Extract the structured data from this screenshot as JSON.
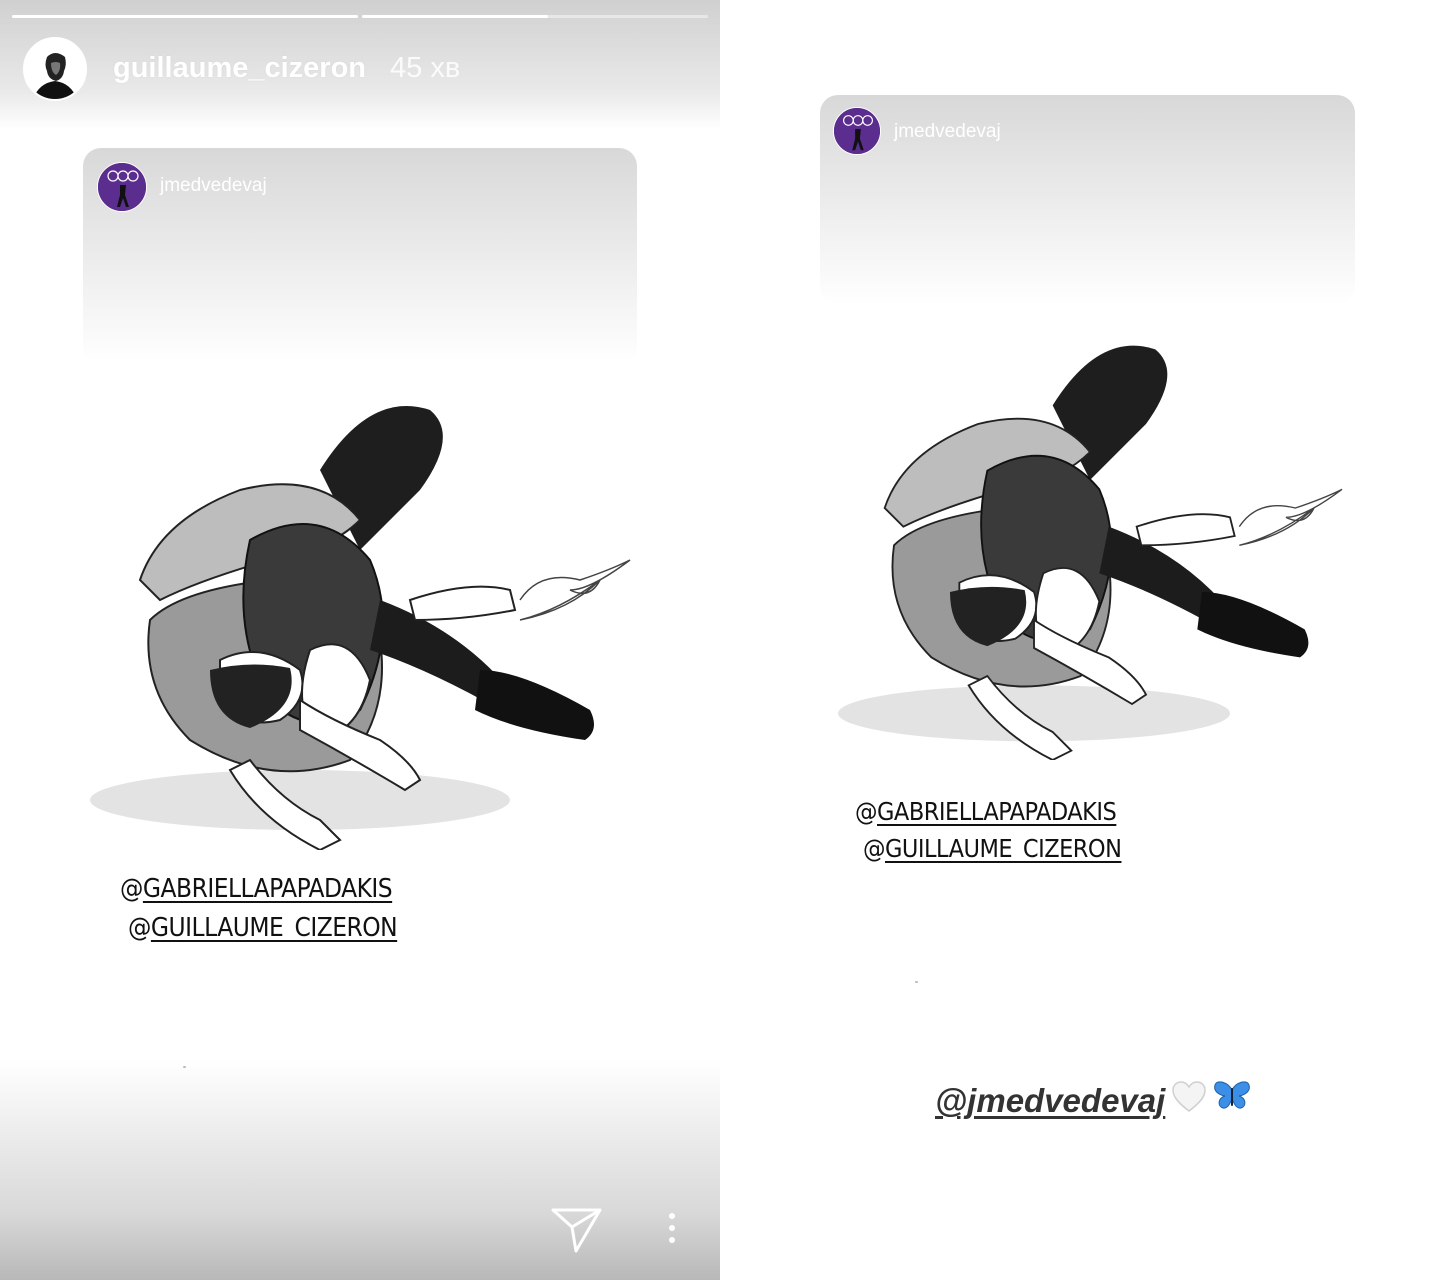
{
  "story": {
    "username": "guillaume_cizeron",
    "time": "45 хв",
    "progress_bars": [
      1.0,
      0.54
    ]
  },
  "repost": {
    "username": "jmedvedevaj"
  },
  "mentions": {
    "line1_at": "@",
    "line1_name": "GABRIELLAPAPADAKIS",
    "line2_at": "@",
    "line2_name": "GUILLAUME_CIZERON"
  },
  "caption": {
    "mention": "@jmedvedevaj",
    "emojis": [
      "white-heart",
      "blue-butterfly"
    ]
  },
  "icons": [
    "send-icon",
    "more-options-icon"
  ]
}
